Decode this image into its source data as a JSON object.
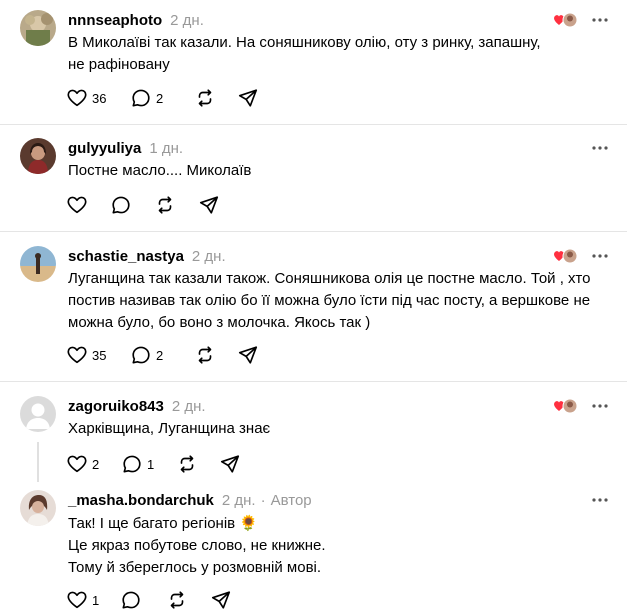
{
  "posts": [
    {
      "username": "nnnseaphoto",
      "time": "2 дн.",
      "lines": [
        "В Миколаїві так казали. На соняшникову олію, оту з ринку, запашну,",
        "не рафіновану"
      ],
      "likes": "36",
      "replies": "2",
      "liked_by_author": true
    },
    {
      "username": "gulyyuliya",
      "time": "1 дн.",
      "lines": [
        "Постне масло.... Миколаїв"
      ],
      "likes": "",
      "replies": "",
      "liked_by_author": false
    },
    {
      "username": "schastie_nastya",
      "time": "2 дн.",
      "lines": [
        "Луганщина так казали також. Соняшникова олія це постне масло. Той , хто",
        "постив називав так олію бо її можна було їсти під час посту, а вершкове не",
        "можна було, бо воно з молочка. Якось так )"
      ],
      "likes": "35",
      "replies": "2",
      "liked_by_author": true
    },
    {
      "username": "zagoruiko843",
      "time": "2 дн.",
      "lines": [
        "Харківщина, Луганщина знає"
      ],
      "likes": "2",
      "replies": "1",
      "liked_by_author": true
    },
    {
      "username": "_masha.bondarchuk",
      "time": "2 дн.",
      "author_sep": "·",
      "author_label": "Автор",
      "lines": [
        "Так! І ще багато регіонів 🌻",
        "Це якраз побутове слово, не книжне.",
        "Тому й збереглось у розмовній мові."
      ],
      "likes": "1",
      "replies": "",
      "liked_by_author": false
    }
  ],
  "icons": {
    "like": "heart-outline-icon",
    "reply": "speech-bubble-icon",
    "repost": "repost-arrows-icon",
    "share": "paper-plane-icon",
    "more": "ellipsis-icon",
    "liked_by_author": "red-heart-with-avatar-icon"
  },
  "colors": {
    "text": "#000000",
    "muted": "#999999",
    "divider": "#e5e5e5",
    "liked_heart": "#ff3040"
  }
}
